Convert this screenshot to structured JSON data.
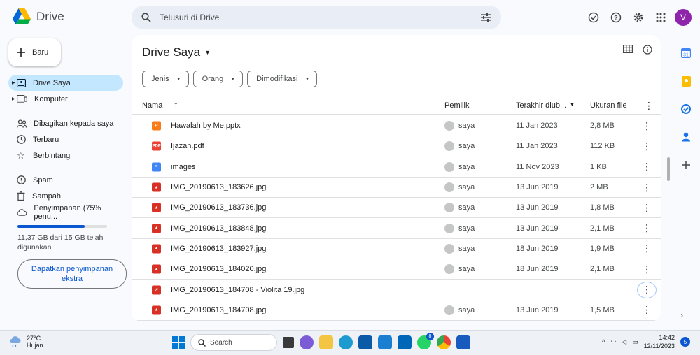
{
  "app": {
    "name": "Drive"
  },
  "search": {
    "placeholder": "Telusuri di Drive"
  },
  "user": {
    "initial": "V"
  },
  "new_button": {
    "label": "Baru"
  },
  "sidebar": {
    "items": [
      {
        "label": "Drive Saya",
        "icon": "drive-icon",
        "active": true
      },
      {
        "label": "Komputer",
        "icon": "computer-icon"
      },
      {
        "label": "Dibagikan kepada saya",
        "icon": "shared-icon"
      },
      {
        "label": "Terbaru",
        "icon": "clock-icon"
      },
      {
        "label": "Berbintang",
        "icon": "star-icon"
      },
      {
        "label": "Spam",
        "icon": "spam-icon"
      },
      {
        "label": "Sampah",
        "icon": "trash-icon"
      },
      {
        "label": "Penyimpanan (75% penu...",
        "icon": "cloud-icon"
      }
    ],
    "storage_used_fraction": 0.75,
    "storage_text": "11,37 GB dari 15 GB telah digunakan",
    "get_storage_label": "Dapatkan penyimpanan ekstra"
  },
  "main": {
    "title": "Drive Saya",
    "filters": [
      "Jenis",
      "Orang",
      "Dimodifikasi"
    ],
    "columns": {
      "name": "Nama",
      "owner": "Pemilik",
      "modified": "Terakhir diub...",
      "size": "Ukuran file"
    },
    "rows": [
      {
        "name": "Hawalah by Me.pptx",
        "type": "pptx",
        "owner": "saya",
        "date": "11 Jan 2023",
        "size": "2,8 MB"
      },
      {
        "name": "Ijazah.pdf",
        "type": "pdf",
        "owner": "saya",
        "date": "11 Jan 2023",
        "size": "112 KB"
      },
      {
        "name": "images",
        "type": "doc",
        "owner": "saya",
        "date": "11 Nov 2023",
        "size": "1 KB"
      },
      {
        "name": "IMG_20190613_183626.jpg",
        "type": "img",
        "owner": "saya",
        "date": "13 Jun 2019",
        "size": "2 MB"
      },
      {
        "name": "IMG_20190613_183736.jpg",
        "type": "img",
        "owner": "saya",
        "date": "13 Jun 2019",
        "size": "1,8 MB"
      },
      {
        "name": "IMG_20190613_183848.jpg",
        "type": "img",
        "owner": "saya",
        "date": "13 Jun 2019",
        "size": "2,1 MB"
      },
      {
        "name": "IMG_20190613_183927.jpg",
        "type": "img",
        "owner": "saya",
        "date": "18 Jun 2019",
        "size": "1,9 MB"
      },
      {
        "name": "IMG_20190613_184020.jpg",
        "type": "img",
        "owner": "saya",
        "date": "18 Jun 2019",
        "size": "2,1 MB"
      },
      {
        "name": "IMG_20190613_184708 - Violita 19.jpg",
        "type": "img-shortcut",
        "owner": "",
        "date": "",
        "size": ""
      },
      {
        "name": "IMG_20190613_184708.jpg",
        "type": "img",
        "owner": "saya",
        "date": "13 Jun 2019",
        "size": "1,5 MB"
      }
    ]
  },
  "taskbar": {
    "weather_temp": "27°C",
    "weather_desc": "Hujan",
    "search_label": "Search",
    "time": "14:42",
    "date": "12/11/2023",
    "notifications": "5",
    "whatsapp_badge": "8"
  },
  "colors": {
    "accent": "#0b57d0",
    "active_nav": "#c2e7ff",
    "pptx": "#fa7b17",
    "pdf": "#ea4335",
    "img": "#d93025",
    "doc": "#4285f4"
  }
}
